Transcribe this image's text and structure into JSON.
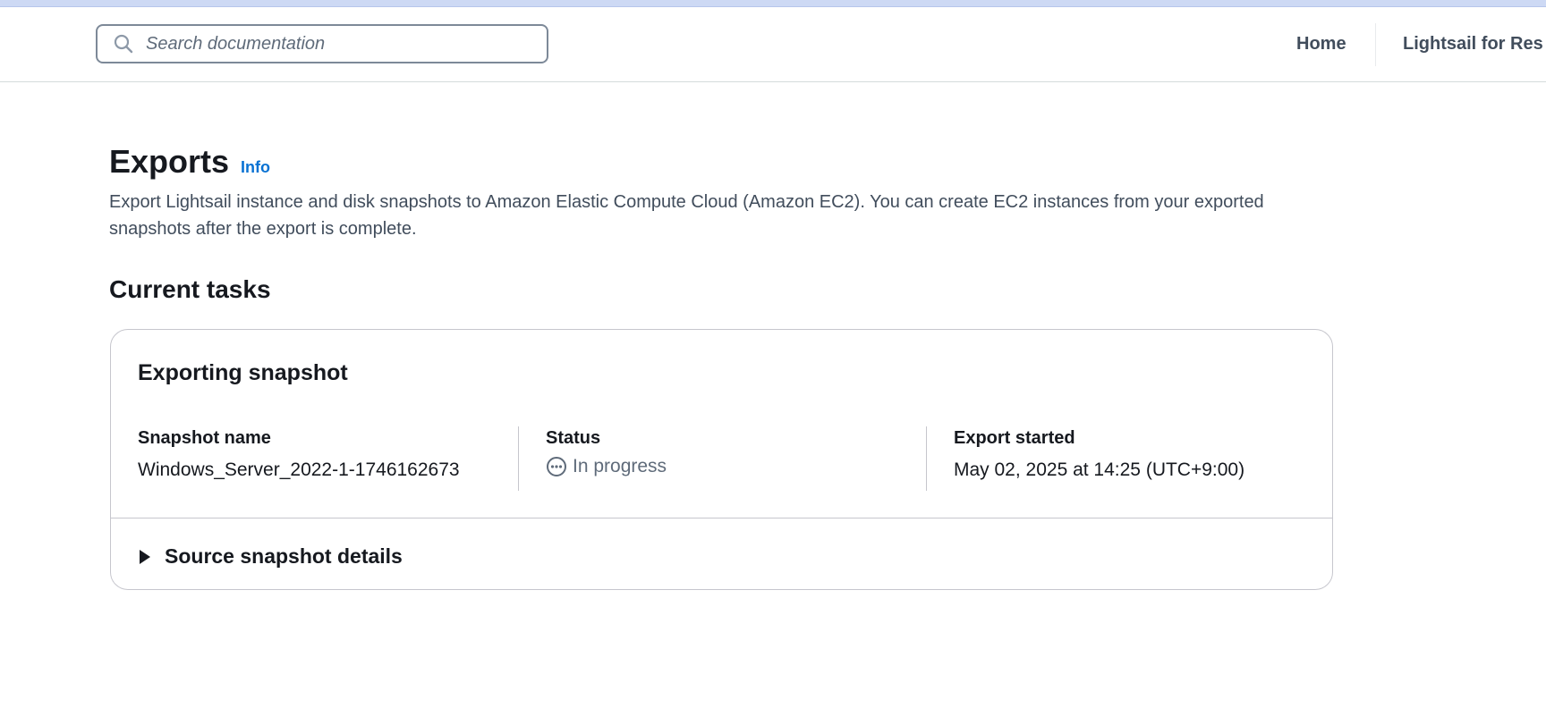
{
  "header": {
    "search_placeholder": "Search documentation",
    "nav_home": "Home",
    "nav_lightsail": "Lightsail for Res"
  },
  "page": {
    "title": "Exports",
    "info_link": "Info",
    "description": "Export Lightsail instance and disk snapshots to Amazon Elastic Compute Cloud (Amazon EC2). You can create EC2 instances from your exported snapshots after the export is complete."
  },
  "current_tasks": {
    "heading": "Current tasks",
    "card": {
      "title": "Exporting snapshot",
      "snapshot_name_label": "Snapshot name",
      "snapshot_name_value": "Windows_Server_2022-1-1746162673",
      "status_label": "Status",
      "status_value": "In progress",
      "export_started_label": "Export started",
      "export_started_value": "May 02, 2025 at 14:25 (UTC+9:00)",
      "source_details_label": "Source snapshot details"
    }
  },
  "icons": {
    "search": "search-icon",
    "status": "in-progress-icon",
    "expander": "caret-right-icon"
  },
  "colors": {
    "link": "#0972d3",
    "text": "#16191f",
    "muted": "#5f6b7a"
  }
}
